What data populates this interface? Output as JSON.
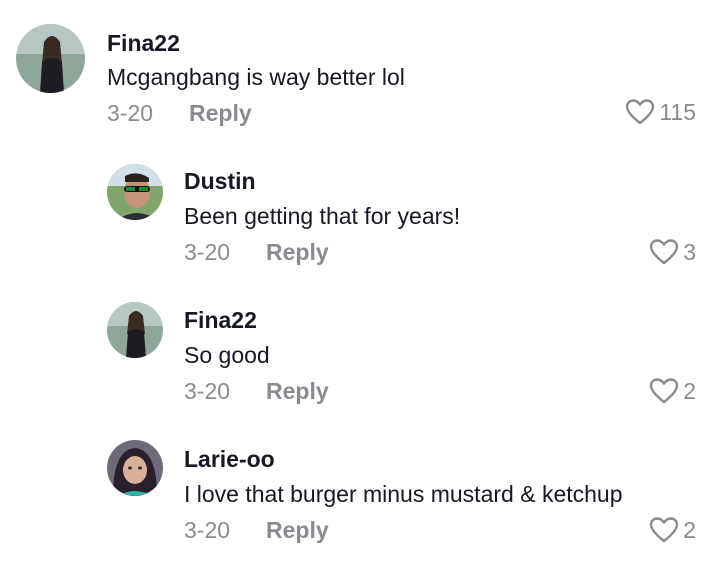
{
  "comments": [
    {
      "username": "Fina22",
      "text": "Mcgangbang is way better lol",
      "date": "3-20",
      "reply_label": "Reply",
      "likes": "115",
      "avatar_icon": "profile-photo"
    },
    {
      "username": "Dustin",
      "text": "Been getting that for years!",
      "date": "3-20",
      "reply_label": "Reply",
      "likes": "3",
      "avatar_icon": "profile-photo"
    },
    {
      "username": "Fina22",
      "text": "So good",
      "date": "3-20",
      "reply_label": "Reply",
      "likes": "2",
      "avatar_icon": "profile-photo"
    },
    {
      "username": "Larie-oo",
      "text": "I love that burger minus mustard & ketchup",
      "date": "3-20",
      "reply_label": "Reply",
      "likes": "2",
      "avatar_icon": "profile-photo"
    }
  ],
  "colors": {
    "text": "#161823",
    "secondary": "#8a8b91",
    "background": "#ffffff"
  },
  "icons": {
    "like": "heart-outline-icon"
  }
}
